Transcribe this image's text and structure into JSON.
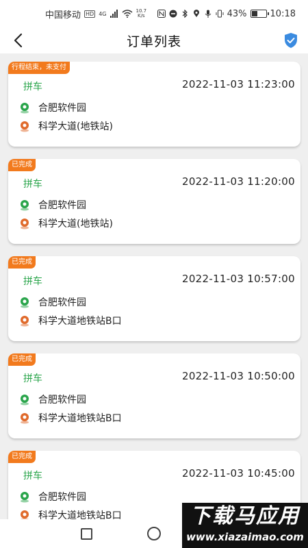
{
  "status_bar": {
    "carrier": "中国移动",
    "hd": "HD",
    "network": "4G",
    "speed_value": "10.7",
    "speed_unit": "K/s",
    "battery_text": "43%",
    "battery_level": 0.43,
    "time": "10:18"
  },
  "header": {
    "title": "订单列表",
    "back_icon": "chevron-left",
    "shield_icon": "shield-check"
  },
  "colors": {
    "badge": "#f27a1d",
    "type_green": "#2aa54b",
    "start_pin": "#2aa54b",
    "end_pin": "#e06a2b",
    "shield": "#3b8be0"
  },
  "orders": [
    {
      "status": "行程结束，未支付",
      "type": "拼车",
      "time": "2022-11-03 11:23:00",
      "from": "合肥软件园",
      "to": "科学大道(地铁站)"
    },
    {
      "status": "已完成",
      "type": "拼车",
      "time": "2022-11-03 11:20:00",
      "from": "合肥软件园",
      "to": "科学大道(地铁站)"
    },
    {
      "status": "已完成",
      "type": "拼车",
      "time": "2022-11-03 10:57:00",
      "from": "合肥软件园",
      "to": "科学大道地铁站B口"
    },
    {
      "status": "已完成",
      "type": "拼车",
      "time": "2022-11-03 10:50:00",
      "from": "合肥软件园",
      "to": "科学大道地铁站B口"
    },
    {
      "status": "已完成",
      "type": "拼车",
      "time": "2022-11-03 10:45:00",
      "from": "合肥软件园",
      "to": "科学大道地铁站B口"
    }
  ],
  "watermark": {
    "cn": "下载马应用",
    "en": "www.xiazaimao.com"
  }
}
